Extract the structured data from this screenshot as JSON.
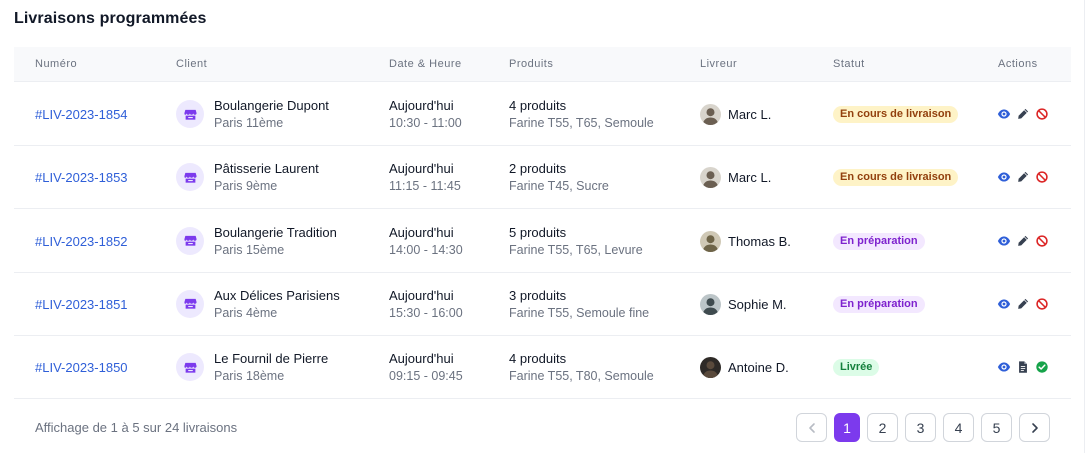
{
  "title": "Livraisons programmées",
  "columns": [
    "Numéro",
    "Client",
    "Date & Heure",
    "Produits",
    "Livreur",
    "Statut",
    "Actions"
  ],
  "colors": {
    "accent": "#7c3aed",
    "link": "#2f5fd8",
    "status_transit_bg": "#fef3c7",
    "status_prep_bg": "#f3e8ff",
    "status_done_bg": "#dcfce7"
  },
  "rows": [
    {
      "number": "#LIV-2023-1854",
      "client_name": "Boulangerie Dupont",
      "client_city": "Paris 11ème",
      "day": "Aujourd'hui",
      "time": "10:30 - 11:00",
      "product_count": "4 produits",
      "product_list": "Farine T55, T65, Semoule",
      "driver": "Marc L.",
      "status": "En cours de livraison",
      "status_kind": "transit",
      "actions": [
        "view-icon",
        "edit-icon",
        "cancel-icon"
      ]
    },
    {
      "number": "#LIV-2023-1853",
      "client_name": "Pâtisserie Laurent",
      "client_city": "Paris 9ème",
      "day": "Aujourd'hui",
      "time": "11:15 - 11:45",
      "product_count": "2 produits",
      "product_list": "Farine T45, Sucre",
      "driver": "Marc L.",
      "status": "En cours de livraison",
      "status_kind": "transit",
      "actions": [
        "view-icon",
        "edit-icon",
        "cancel-icon"
      ]
    },
    {
      "number": "#LIV-2023-1852",
      "client_name": "Boulangerie Tradition",
      "client_city": "Paris 15ème",
      "day": "Aujourd'hui",
      "time": "14:00 - 14:30",
      "product_count": "5 produits",
      "product_list": "Farine T55, T65, Levure",
      "driver": "Thomas B.",
      "status": "En préparation",
      "status_kind": "prep",
      "actions": [
        "view-icon",
        "edit-icon",
        "cancel-icon"
      ]
    },
    {
      "number": "#LIV-2023-1851",
      "client_name": "Aux Délices Parisiens",
      "client_city": "Paris 4ème",
      "day": "Aujourd'hui",
      "time": "15:30 - 16:00",
      "product_count": "3 produits",
      "product_list": "Farine T55, Semoule fine",
      "driver": "Sophie M.",
      "status": "En préparation",
      "status_kind": "prep",
      "actions": [
        "view-icon",
        "edit-icon",
        "cancel-icon"
      ]
    },
    {
      "number": "#LIV-2023-1850",
      "client_name": "Le Fournil de Pierre",
      "client_city": "Paris 18ème",
      "day": "Aujourd'hui",
      "time": "09:15 - 09:45",
      "product_count": "4 produits",
      "product_list": "Farine T55, T80, Semoule",
      "driver": "Antoine D.",
      "status": "Livrée",
      "status_kind": "done",
      "actions": [
        "view-icon",
        "document-icon",
        "check-icon"
      ]
    }
  ],
  "footer": {
    "summary": "Affichage de 1 à 5 sur 24 livraisons",
    "pages": [
      "1",
      "2",
      "3",
      "4",
      "5"
    ],
    "current_page": "1"
  }
}
